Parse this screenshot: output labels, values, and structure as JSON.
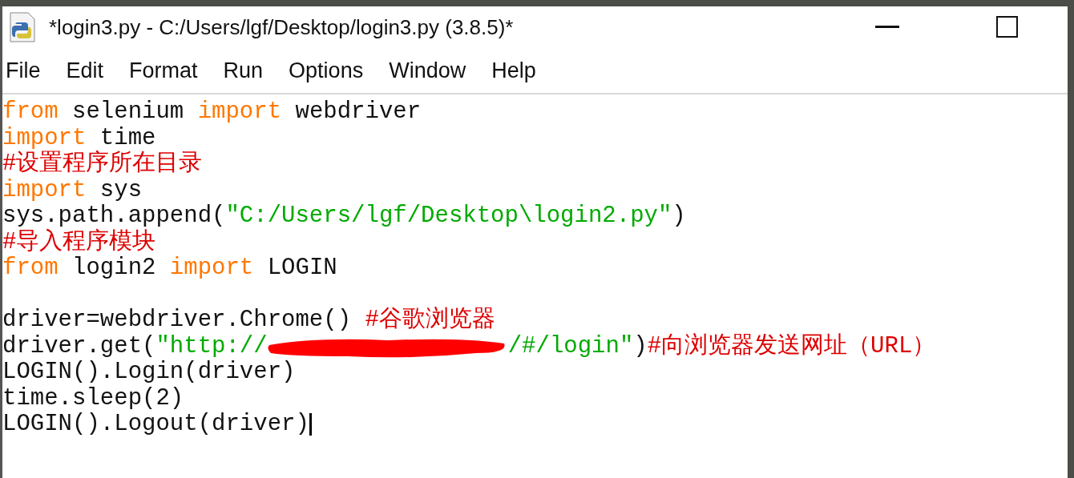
{
  "window": {
    "title": "*login3.py - C:/Users/lgf/Desktop/login3.py (3.8.5)*"
  },
  "menu": [
    {
      "label": "File"
    },
    {
      "label": "Edit"
    },
    {
      "label": "Format"
    },
    {
      "label": "Run"
    },
    {
      "label": "Options"
    },
    {
      "label": "Window"
    },
    {
      "label": "Help"
    }
  ],
  "editor": {
    "lines": [
      {
        "kind": "code",
        "tokens": [
          {
            "kind": "keyword",
            "text": "from"
          },
          {
            "kind": "plain",
            "text": " selenium "
          },
          {
            "kind": "keyword",
            "text": "import"
          },
          {
            "kind": "plain",
            "text": " webdriver"
          }
        ]
      },
      {
        "kind": "code",
        "tokens": [
          {
            "kind": "keyword",
            "text": "import"
          },
          {
            "kind": "plain",
            "text": " time"
          }
        ]
      },
      {
        "kind": "code",
        "tokens": [
          {
            "kind": "comment",
            "text": "#设置程序所在目录"
          }
        ]
      },
      {
        "kind": "code",
        "tokens": [
          {
            "kind": "keyword",
            "text": "import"
          },
          {
            "kind": "plain",
            "text": " sys"
          }
        ]
      },
      {
        "kind": "code",
        "tokens": [
          {
            "kind": "plain",
            "text": "sys.path.append("
          },
          {
            "kind": "string",
            "text": "\"C:/Users/lgf/Desktop\\login2.py\""
          },
          {
            "kind": "plain",
            "text": ")"
          }
        ]
      },
      {
        "kind": "code",
        "tokens": [
          {
            "kind": "comment",
            "text": "#导入程序模块"
          }
        ]
      },
      {
        "kind": "code",
        "tokens": [
          {
            "kind": "keyword",
            "text": "from"
          },
          {
            "kind": "plain",
            "text": " login2 "
          },
          {
            "kind": "keyword",
            "text": "import"
          },
          {
            "kind": "plain",
            "text": " LOGIN"
          }
        ]
      },
      {
        "kind": "blank"
      },
      {
        "kind": "code",
        "tokens": [
          {
            "kind": "plain",
            "text": "driver=webdriver.Chrome() "
          },
          {
            "kind": "comment",
            "text": "#谷歌浏览器"
          }
        ]
      },
      {
        "kind": "code",
        "tokens": [
          {
            "kind": "plain",
            "text": "driver.get("
          },
          {
            "kind": "string",
            "text": "\"http://"
          },
          {
            "kind": "redaction"
          },
          {
            "kind": "string",
            "text": "/#/login\""
          },
          {
            "kind": "plain",
            "text": ")"
          },
          {
            "kind": "comment",
            "text": "#向浏览器发送网址（URL）"
          }
        ]
      },
      {
        "kind": "code",
        "tokens": [
          {
            "kind": "plain",
            "text": "LOGIN().Login(driver)"
          }
        ]
      },
      {
        "kind": "code",
        "tokens": [
          {
            "kind": "plain",
            "text": "time.sleep(2)"
          }
        ]
      },
      {
        "kind": "code",
        "cursor": true,
        "tokens": [
          {
            "kind": "plain",
            "text": "LOGIN().Logout(driver)"
          }
        ]
      }
    ]
  }
}
